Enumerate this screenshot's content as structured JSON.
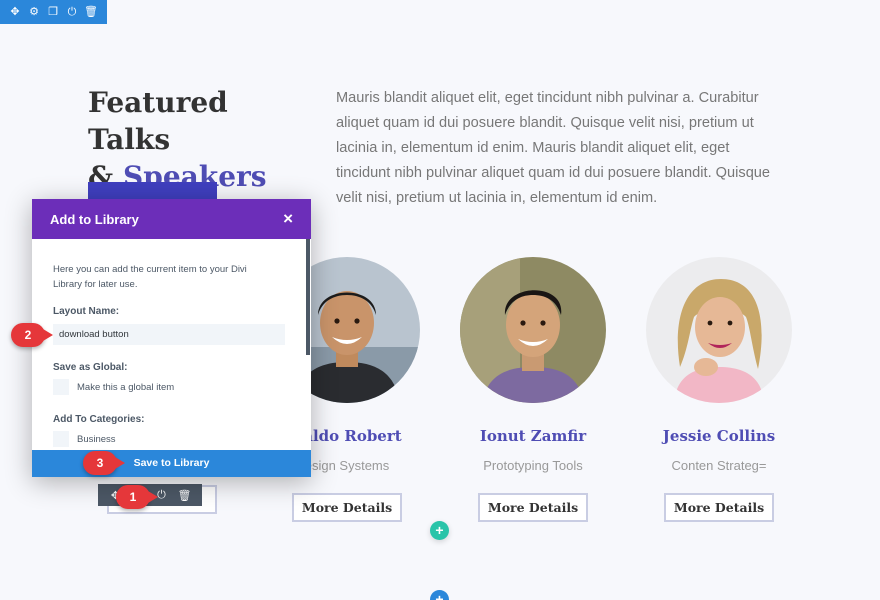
{
  "section_toolbar": {
    "icons": [
      "move-icon",
      "gear-icon",
      "duplicate-icon",
      "power-icon",
      "trash-icon"
    ]
  },
  "hero": {
    "title_line1": "Featured Talks",
    "title_amp": "&",
    "title_accent": "Speakers",
    "intro": "Mauris blandit aliquet elit, eget tincidunt nibh pulvinar a. Curabitur aliquet quam id dui posuere blandit. Quisque velit nisi, pretium ut lacinia in, elementum id enim. Mauris blandit aliquet elit, eget tincidunt nibh pulvinar aliquet quam id dui posuere blandit. Quisque velit nisi, pretium ut lacinia in, elementum id enim."
  },
  "speakers": [
    {
      "name": "naldo Robert",
      "role": "esign Systems",
      "button": "More Details"
    },
    {
      "name": "Ionut Zamfir",
      "role": "Prototyping Tools",
      "button": "More Details"
    },
    {
      "name": "Jessie Collins",
      "role": "Conten Strateg=",
      "button": "More Details"
    }
  ],
  "modal": {
    "title": "Add to Library",
    "close": "×",
    "description": "Here you can add the current item to your Divi Library for later use.",
    "layout_name_label": "Layout Name:",
    "layout_name_value": "download button",
    "global_label": "Save as Global:",
    "global_checkbox": "Make this a global item",
    "categories_label": "Add To Categories:",
    "category_first": "Business",
    "save_button": "Save to Library"
  },
  "module_toolbar": {
    "icons": [
      "move-icon",
      "save-icon",
      "power-icon",
      "trash-icon"
    ]
  },
  "steps": [
    "1",
    "2",
    "3"
  ],
  "colors": {
    "purple_header": "#6c2eb9",
    "divi_blue": "#2b87da",
    "accent_text": "#4f4db4",
    "step_red": "#e5373a",
    "add_green": "#29c4a9"
  }
}
